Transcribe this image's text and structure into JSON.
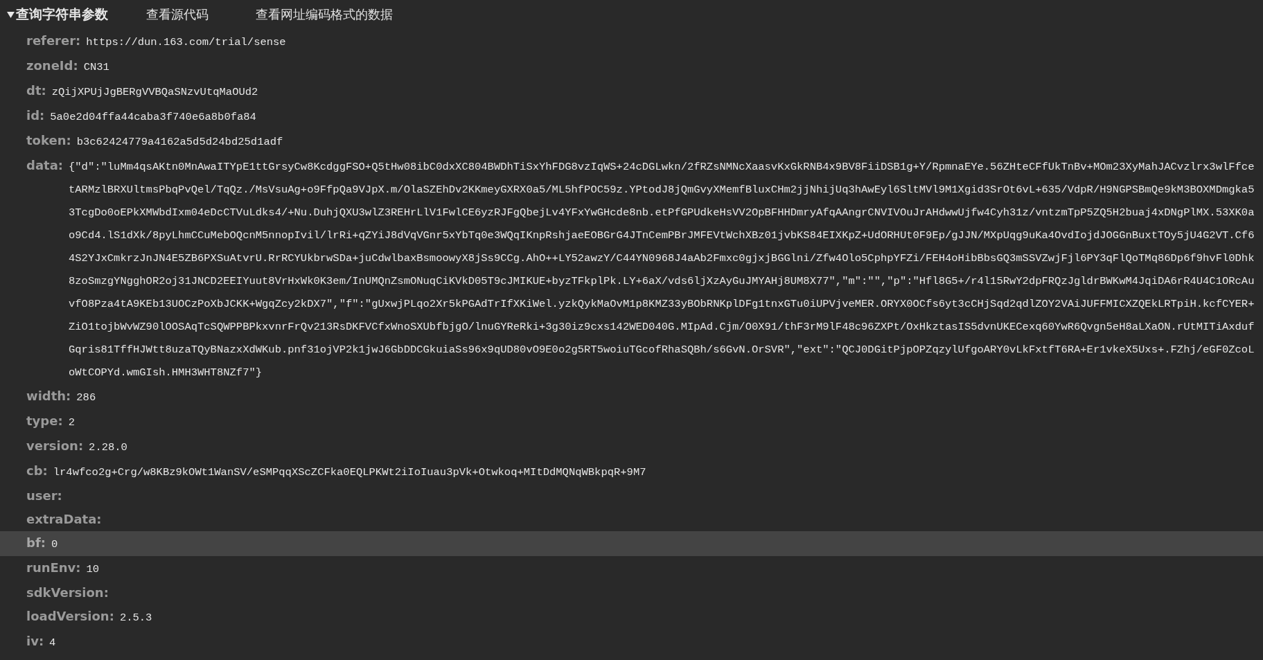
{
  "section": {
    "title": "查询字符串参数",
    "expanded": true
  },
  "links": [
    "查看源代码",
    "查看网址编码格式的数据"
  ],
  "params": [
    {
      "key": "referer:",
      "value": "https://dun.163.com/trial/sense",
      "selected": false
    },
    {
      "key": "zoneId:",
      "value": "CN31",
      "selected": false
    },
    {
      "key": "dt:",
      "value": "zQijXPUjJgBERgVVBQaSNzvUtqMaOUd2",
      "selected": false
    },
    {
      "key": "id:",
      "value": "5a0e2d04ffa44caba3f740e6a8b0fa84",
      "selected": false
    },
    {
      "key": "token:",
      "value": "b3c62424779a4162a5d5d24bd25d1adf",
      "selected": false
    },
    {
      "key": "data:",
      "value": "{\"d\":\"luMm4qsAKtn0MnAwaITYpE1ttGrsyCw8KcdggFSO+Q5tHw08ibC0dxXC804BWDhTiSxYhFDG8vzIqWS+24cDGLwkn/2fRZsNMNcXaasvKxGkRNB4x9BV8FiiDSB1g+Y/RpmnaEYe.56ZHteCFfUkTnBv+MOm23XyMahJACvzlrx3wlFfcetARMzlBRXUltmsPbqPvQel/TqQz./MsVsuAg+o9FfpQa9VJpX.m/OlaSZEhDv2KKmeyGXRX0a5/ML5hfPOC59z.YPtodJ8jQmGvyXMemfBluxCHm2jjNhijUq3hAwEyl6SltMVl9M1Xgid3SrOt6vL+635/VdpR/H9NGPSBmQe9kM3BOXMDmgka53TcgDo0oEPkXMWbdIxm04eDcCTVuLdks4/+Nu.DuhjQXU3wlZ3REHrLlV1FwlCE6yzRJFgQbejLv4YFxYwGHcde8nb.etPfGPUdkeHsVV2OpBFHHDmryAfqAAngrCNVIVOuJrAHdwwUjfw4Cyh31z/vntzmTpP5ZQ5H2buaj4xDNgPlMX.53XK0ao9Cd4.lS1dXk/8pyLhmCCuMebOQcnM5nnopIvil/lrRi+qZYiJ8dVqVGnr5xYbTq0e3WQqIKnpRshjaeEOBGrG4JTnCemPBrJMFEVtWchXBz01jvbKS84EIXKpZ+UdORHUt0F9Ep/gJJN/MXpUqg9uKa4OvdIojdJOGGnBuxtTOy5jU4G2VT.Cf64S2YJxCmkrzJnJN4E5ZB6PXSuAtvrU.RrRCYUkbrwSDa+juCdwlbaxBsmoowyX8jSs9CCg.AhO++LY52awzY/C44YN0968J4aAb2Fmxc0gjxjBGGlni/Zfw4Olo5CphpYFZi/FEH4oHibBbsGQ3mSSVZwjFjl6PY3qFlQoTMq86Dp6f9hvFl0Dhk8zoSmzgYNgghOR2oj31JNCD2EEIYuut8VrHxWk0K3em/InUMQnZsmONuqCiKVkD05T9cJMIKUE+byzTFkplPk.LY+6aX/vds6ljXzAyGuJMYAHj8UM8X77\",\"m\":\"\",\"p\":\"Hfl8G5+/r4l15RwY2dpFRQzJgldrBWKwM4JqiDA6rR4U4C1ORcAuvfO8Pza4tA9KEb13UOCzPoXbJCKK+WgqZcy2kDX7\",\"f\":\"gUxwjPLqo2Xr5kPGAdTrIfXKiWel.yzkQykMaOvM1p8KMZ33yBObRNKplDFg1tnxGTu0iUPVjveMER.ORYX0OCfs6yt3cCHjSqd2qdlZOY2VAiJUFFMICXZQEkLRTpiH.kcfCYER+ZiO1tojbWvWZ90lOOSAqTcSQWPPBPkxvnrFrQv213RsDKFVCfxWnoSXUbfbjgO/lnuGYReRki+3g30iz9cxs142WED040G.MIpAd.Cjm/O0X91/thF3rM9lF48c96ZXPt/OxHkztasIS5dvnUKECexq60YwR6Qvgn5eH8aLXaON.rUtMITiAxdufGqris81TffHJWtt8uzaTQyBNazxXdWKub.pnf31ojVP2k1jwJ6GbDDCGkuiaSs96x9qUD80vO9E0o2g5RT5woiuTGcofRhaSQBh/s6GvN.OrSVR\",\"ext\":\"QCJ0DGitPjpOPZqzylUfgoARY0vLkFxtfT6RA+Er1vkeX5Uxs+.FZhj/eGF0ZcoLoWtCOPYd.wmGIsh.HMH3WHT8NZf7\"}",
      "selected": false
    },
    {
      "key": "width:",
      "value": "286",
      "selected": false
    },
    {
      "key": "type:",
      "value": "2",
      "selected": false
    },
    {
      "key": "version:",
      "value": "2.28.0",
      "selected": false
    },
    {
      "key": "cb:",
      "value": "lr4wfco2g+Crg/w8KBz9kOWt1WanSV/eSMPqqXScZCFka0EQLPKWt2iIoIuau3pVk+Otwkoq+MItDdMQNqWBkpqR+9M7",
      "selected": false
    },
    {
      "key": "user:",
      "selected": false
    },
    {
      "key": "extraData:",
      "selected": false
    },
    {
      "key": "bf:",
      "value": "0",
      "selected": true
    },
    {
      "key": "runEnv:",
      "value": "10",
      "selected": false
    },
    {
      "key": "sdkVersion:",
      "selected": false
    },
    {
      "key": "loadVersion:",
      "value": "2.5.3",
      "selected": false
    },
    {
      "key": "iv:",
      "value": "4",
      "selected": false
    }
  ]
}
